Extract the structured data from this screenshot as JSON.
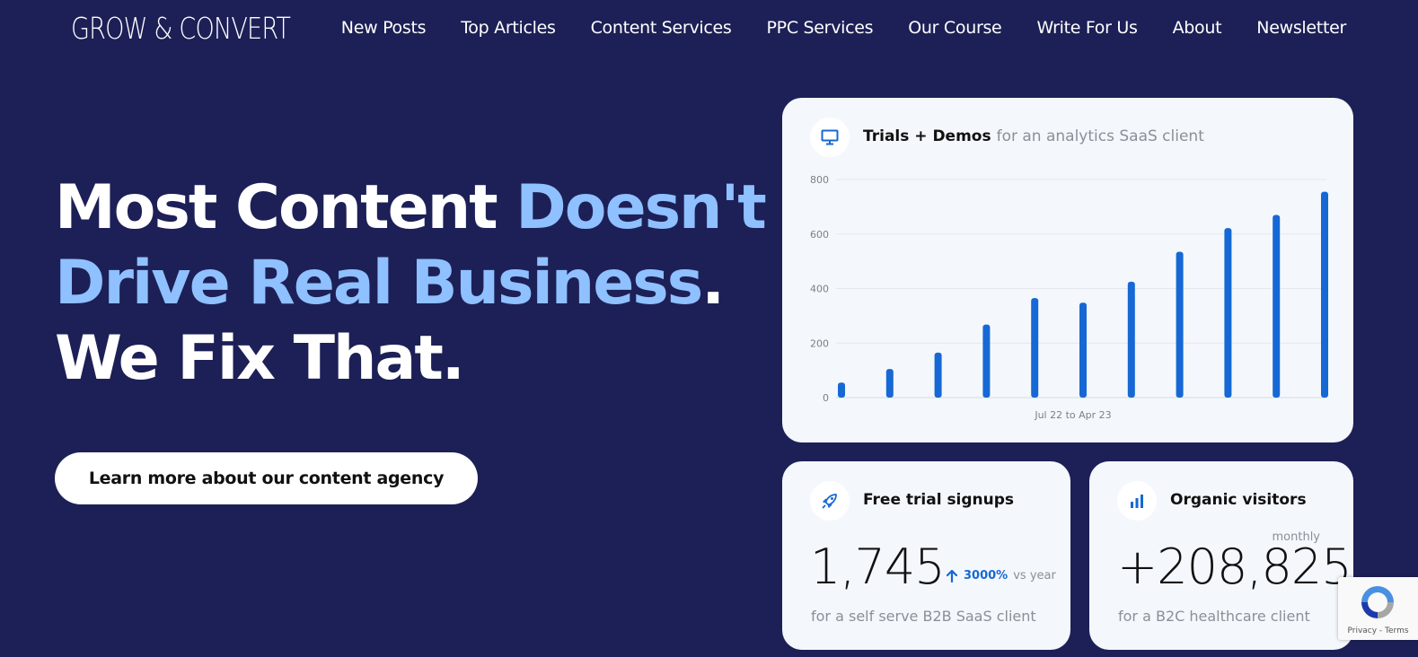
{
  "header": {
    "logo": "GROW & CONVERT",
    "nav": [
      "New Posts",
      "Top Articles",
      "Content Services",
      "PPC Services",
      "Our Course",
      "Write For Us",
      "About",
      "Newsletter"
    ]
  },
  "hero": {
    "line1_white": "Most Content ",
    "line1_accent": "Doesn't",
    "line2_accent": "Drive Real Business",
    "line2_period": ".",
    "line3": "We Fix That.",
    "cta_label": "Learn more about our content agency"
  },
  "colors": {
    "background": "#1d2056",
    "accent": "#8fc0ff",
    "bar": "#1668d4",
    "card": "#f4f8fc"
  },
  "chart_card": {
    "icon": "monitor-icon",
    "title": "Trials + Demos",
    "subtitle": "for an analytics SaaS client"
  },
  "chart_data": {
    "type": "bar",
    "title": "Trials + Demos",
    "xlabel": "Jul 22 to Apr 23",
    "ylabel": "",
    "yticks": [
      0,
      200,
      400,
      600,
      800
    ],
    "ylim": [
      0,
      800
    ],
    "grid": true,
    "values": [
      55,
      105,
      165,
      268,
      365,
      348,
      425,
      535,
      622,
      670,
      755
    ]
  },
  "stat_left": {
    "icon": "rocket-icon",
    "title": "Free trial signups",
    "value": "1,745",
    "delta_pct": "3000%",
    "delta_vs": "vs year",
    "caption": "for a self serve B2B SaaS client"
  },
  "stat_right": {
    "icon": "bar-chart-icon",
    "title": "Organic visitors",
    "period": "monthly",
    "value": "+208,825",
    "caption": "for a B2C healthcare client"
  },
  "recaptcha": {
    "links": "Privacy - Terms"
  }
}
